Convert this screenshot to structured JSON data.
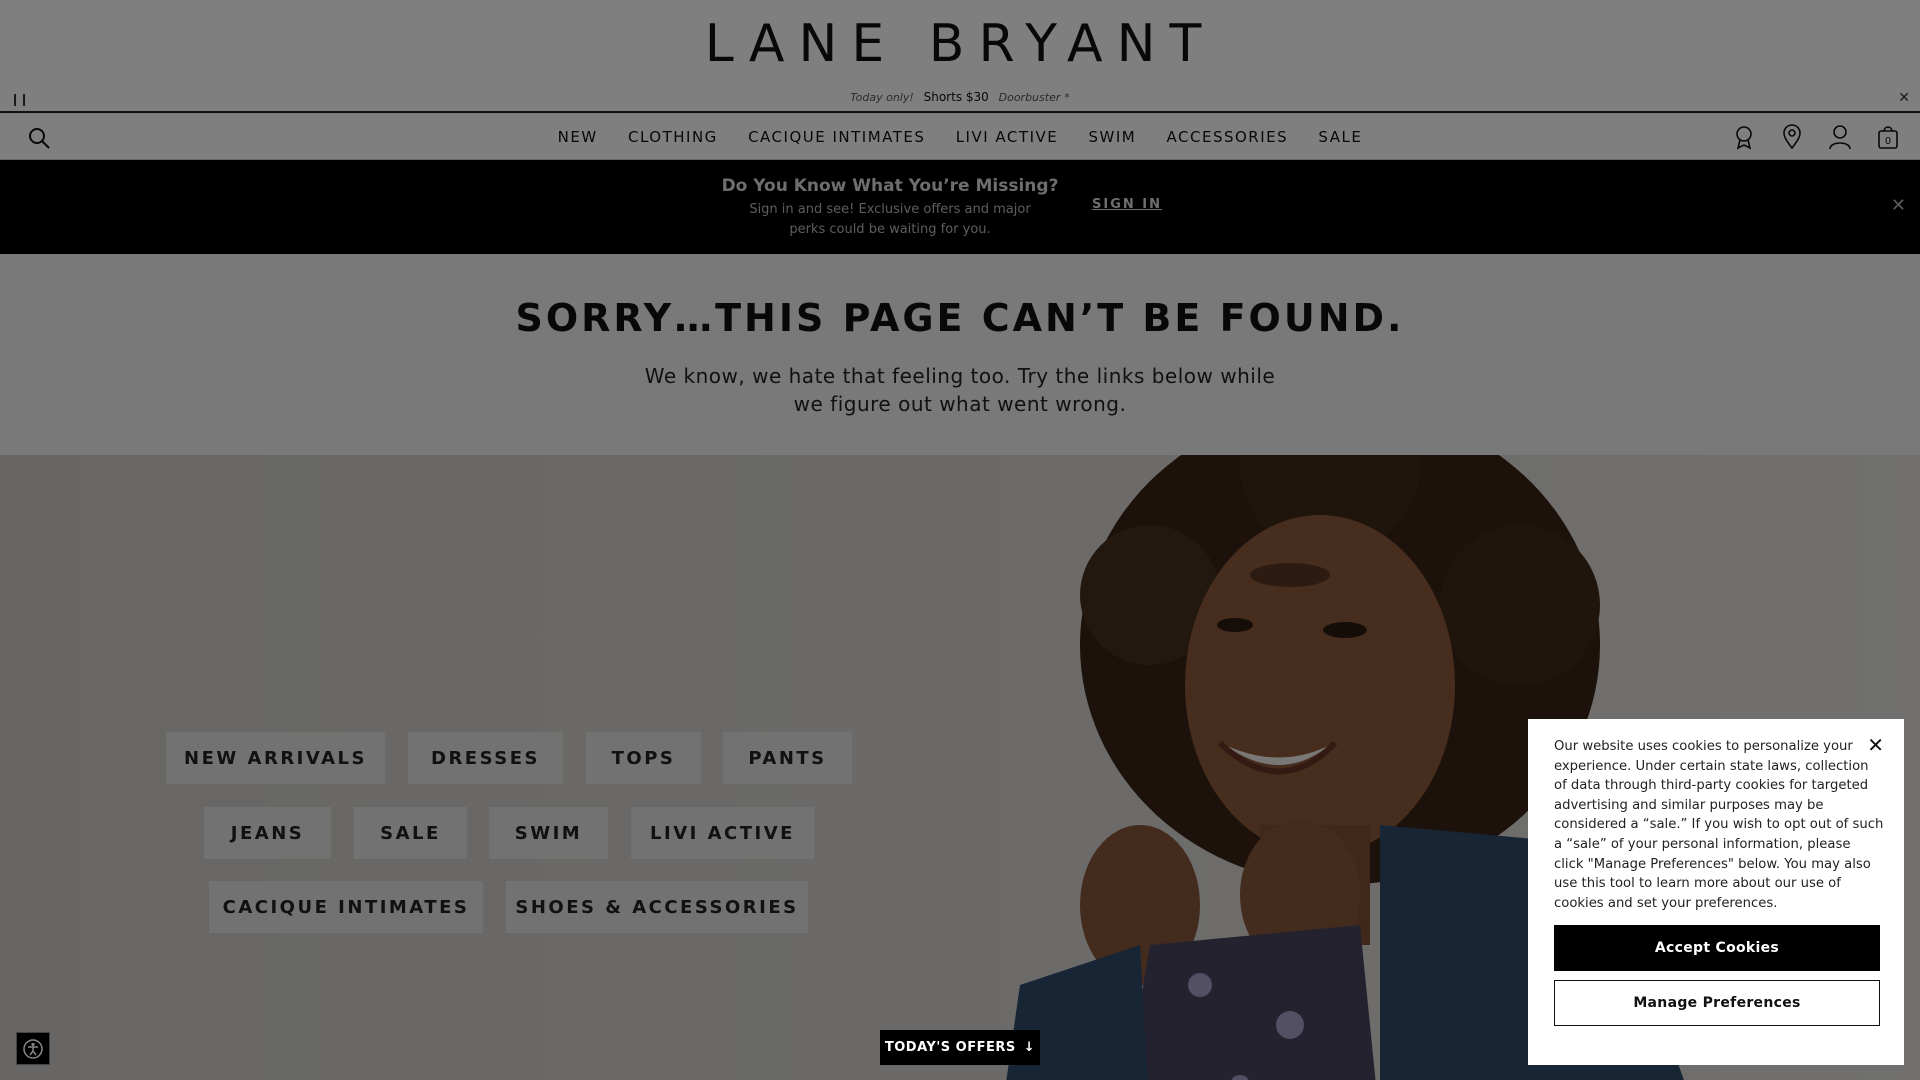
{
  "header": {
    "logo": "LANE BRYANT",
    "promo": {
      "prefix": "Today only!",
      "main": "Shorts $30",
      "suffix": "Doorbuster",
      "mark": "*"
    },
    "nav": [
      "NEW",
      "CLOTHING",
      "CACIQUE INTIMATES",
      "LIVI ACTIVE",
      "SWIM",
      "ACCESSORIES",
      "SALE"
    ],
    "cart_count": "0"
  },
  "signin_banner": {
    "title": "Do You Know What You’re Missing?",
    "subtitle": "Sign in and see! Exclusive offers and major perks could be waiting for you.",
    "link": "SIGN IN"
  },
  "error": {
    "title": "SORRY…THIS PAGE CAN’T BE FOUND.",
    "subtitle": "We know, we hate that feeling too. Try the links below while we figure out what went wrong."
  },
  "categories": [
    "NEW ARRIVALS",
    "DRESSES",
    "TOPS",
    "PANTS",
    "JEANS",
    "SALE",
    "SWIM",
    "LIVI ACTIVE",
    "CACIQUE INTIMATES",
    "SHOES & ACCESSORIES"
  ],
  "offers_button": "TODAY'S OFFERS",
  "cookie": {
    "text": "Our website uses cookies to personalize your experience. Under certain state laws, collection of data through third-party cookies for targeted advertising and similar purposes may be considered a “sale.” If you wish to opt out of such a “sale” of your personal information, please click \"Manage Preferences\" below. You may also use this tool to learn more about our use of cookies and set your preferences.",
    "accept": "Accept Cookies",
    "manage": "Manage Preferences"
  },
  "colors": {
    "overlay": "#000000",
    "button": "#000000"
  }
}
